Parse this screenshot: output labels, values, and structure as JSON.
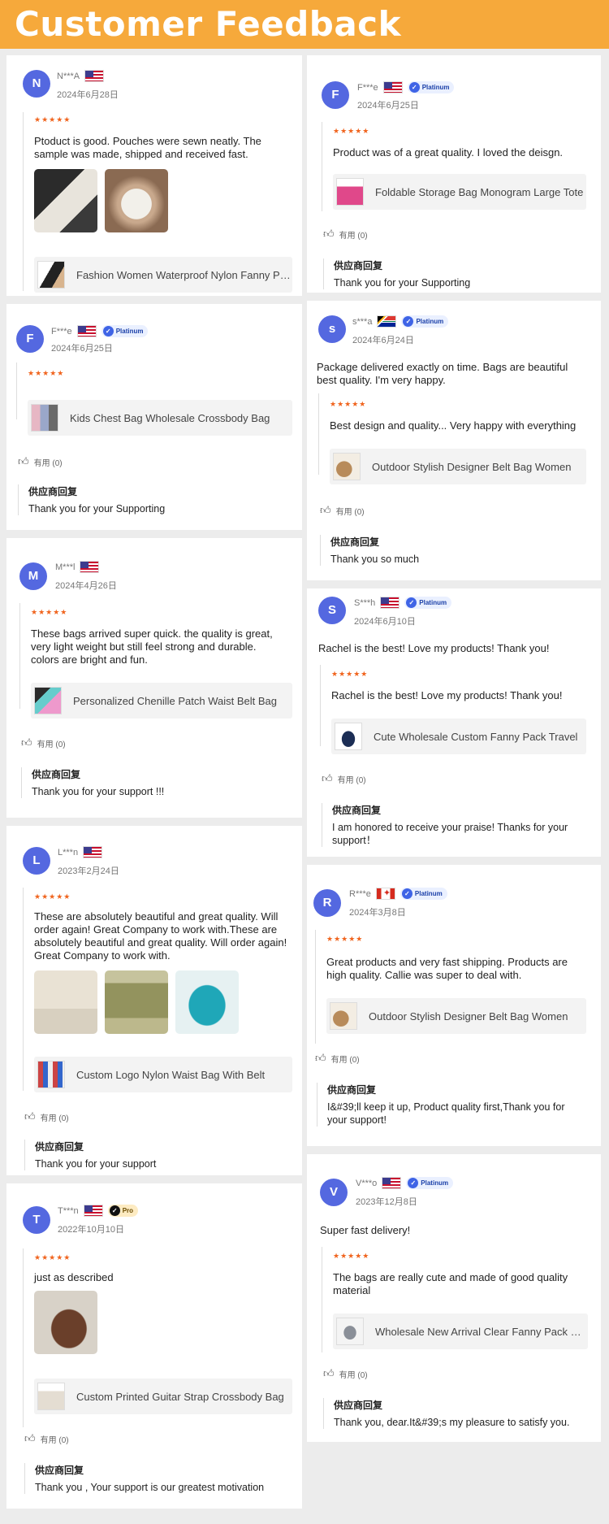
{
  "header": {
    "title": "Customer Feedback"
  },
  "common": {
    "reply_title": "供应商回复",
    "helpful": "有用 (0)"
  },
  "reviews": [
    {
      "avatar": "N",
      "user": "N***A",
      "date": "2024年6月28日",
      "rating": "★★★★★",
      "text": "Ptoduct is good. Pouches were sewn neatly. The sample was made, shipped and received fast.",
      "product": "Fashion Women Waterproof Nylon Fanny Pack"
    },
    {
      "avatar": "F",
      "user": "F***e",
      "badge": "Platinum",
      "date": "2024年6月25日",
      "rating": "★★★★★",
      "text": "Kids Chest Bag Wholesale Crossbody Bag",
      "product": "Kids Chest Bag Wholesale Crossbody Bag",
      "reply": "Thank you for your Supporting"
    },
    {
      "avatar": "M",
      "user": "M***l",
      "date": "2024年4月26日",
      "rating": "★★★★★",
      "text": "These bags arrived super quick. the quality is great, very light weight but still feel strong and durable. colors are bright and fun.",
      "product": "Personalized Chenille Patch Waist Belt Bag",
      "reply": "Thank you for your support !!!"
    },
    {
      "avatar": "L",
      "user": "L***n",
      "date": "2023年2月24日",
      "rating": "★★★★★",
      "text": "These are absolutely beautiful and great quality. Will order again! Great Company to work with.These are absolutely beautiful and great quality. Will order again! Great Company to work with.",
      "product": "Custom Logo Nylon Waist Bag With Belt",
      "reply": "Thank you for your support"
    },
    {
      "avatar": "T",
      "user": "T***n",
      "badge": "Pro",
      "date": "2022年10月10日",
      "rating": "★★★★★",
      "text": "just as described",
      "product": "Custom Printed Guitar Strap Crossbody Bag",
      "reply": "Thank you , Your support is our greatest motivation"
    },
    {
      "avatar": "F",
      "user": "F***e",
      "badge": "Platinum",
      "date": "2024年6月25日",
      "rating": "★★★★★",
      "text": "Product was of a great quality. I loved the deisgn.",
      "product": "Foldable Storage Bag Monogram Large Tote",
      "reply": "Thank you for your Supporting"
    },
    {
      "avatar": "s",
      "user": "s***a",
      "badge": "Platinum",
      "date": "2024年6月24日",
      "rating": "★★★★★",
      "lead": "Package delivered exactly on time. Bags are beautiful best quality. I'm very happy.",
      "text": "Best design and quality... Very happy with everything",
      "product": "Outdoor Stylish Designer Belt Bag Women",
      "reply": "Thank you so much"
    },
    {
      "avatar": "S",
      "user": "S***h",
      "badge": "Platinum",
      "date": "2024年6月10日",
      "rating": "★★★★★",
      "lead": "Rachel is the best! Love my products! Thank you!",
      "text": "Rachel is the best! Love my products! Thank you!",
      "product": "Cute Wholesale Custom Fanny Pack Travel",
      "reply": "I am honored to receive your praise! Thanks for your support！"
    },
    {
      "avatar": "R",
      "user": "R***e",
      "badge": "Platinum",
      "date": "2024年3月8日",
      "rating": "★★★★★",
      "text": "Great products and very fast shipping. Products are high quality. Callie was super to deal with.",
      "product": "Outdoor Stylish Designer Belt Bag Women",
      "reply": "I&#39;ll keep it up, Product quality first,Thank you for your support!"
    },
    {
      "avatar": "V",
      "user": "V***o",
      "badge": "Platinum",
      "date": "2023年12月8日",
      "rating": "★★★★★",
      "lead": "Super fast delivery!",
      "text": "The bags are really cute and made of good quality material",
      "product": "Wholesale New Arrival Clear Fanny Pack Belt",
      "reply": "Thank you, dear.It&#39;s my pleasure to satisfy you."
    }
  ]
}
